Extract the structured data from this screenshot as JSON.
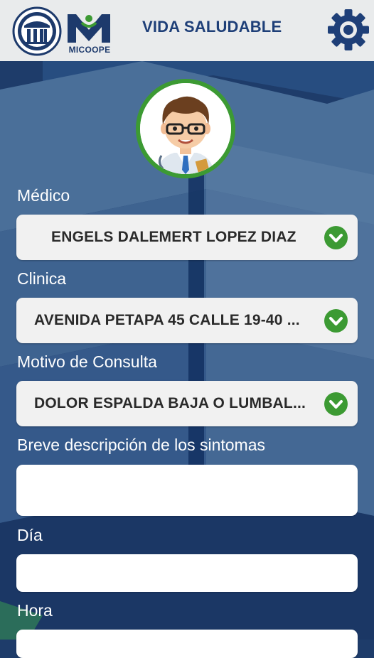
{
  "header": {
    "brand_text": "MICOOPE",
    "title": "VIDA SALUDABLE",
    "settings_icon": "gear-icon"
  },
  "form": {
    "medico": {
      "label": "Médico",
      "value": "ENGELS DALEMERT LOPEZ DIAZ"
    },
    "clinica": {
      "label": "Clinica",
      "value": "AVENIDA PETAPA 45 CALLE 19-40 ..."
    },
    "motivo": {
      "label": "Motivo de Consulta",
      "value": "DOLOR ESPALDA BAJA O LUMBAL..."
    },
    "sintomas": {
      "label": "Breve descripción de los sintomas",
      "value": ""
    },
    "dia": {
      "label": "Día",
      "value": ""
    },
    "hora": {
      "label": "Hora",
      "value": ""
    }
  },
  "colors": {
    "header_bg": "#e9ebec",
    "brand_blue": "#1e3f78",
    "background": "#1e3c6a",
    "accent_green": "#3c9a33",
    "field_bg": "#f1f1f1"
  }
}
